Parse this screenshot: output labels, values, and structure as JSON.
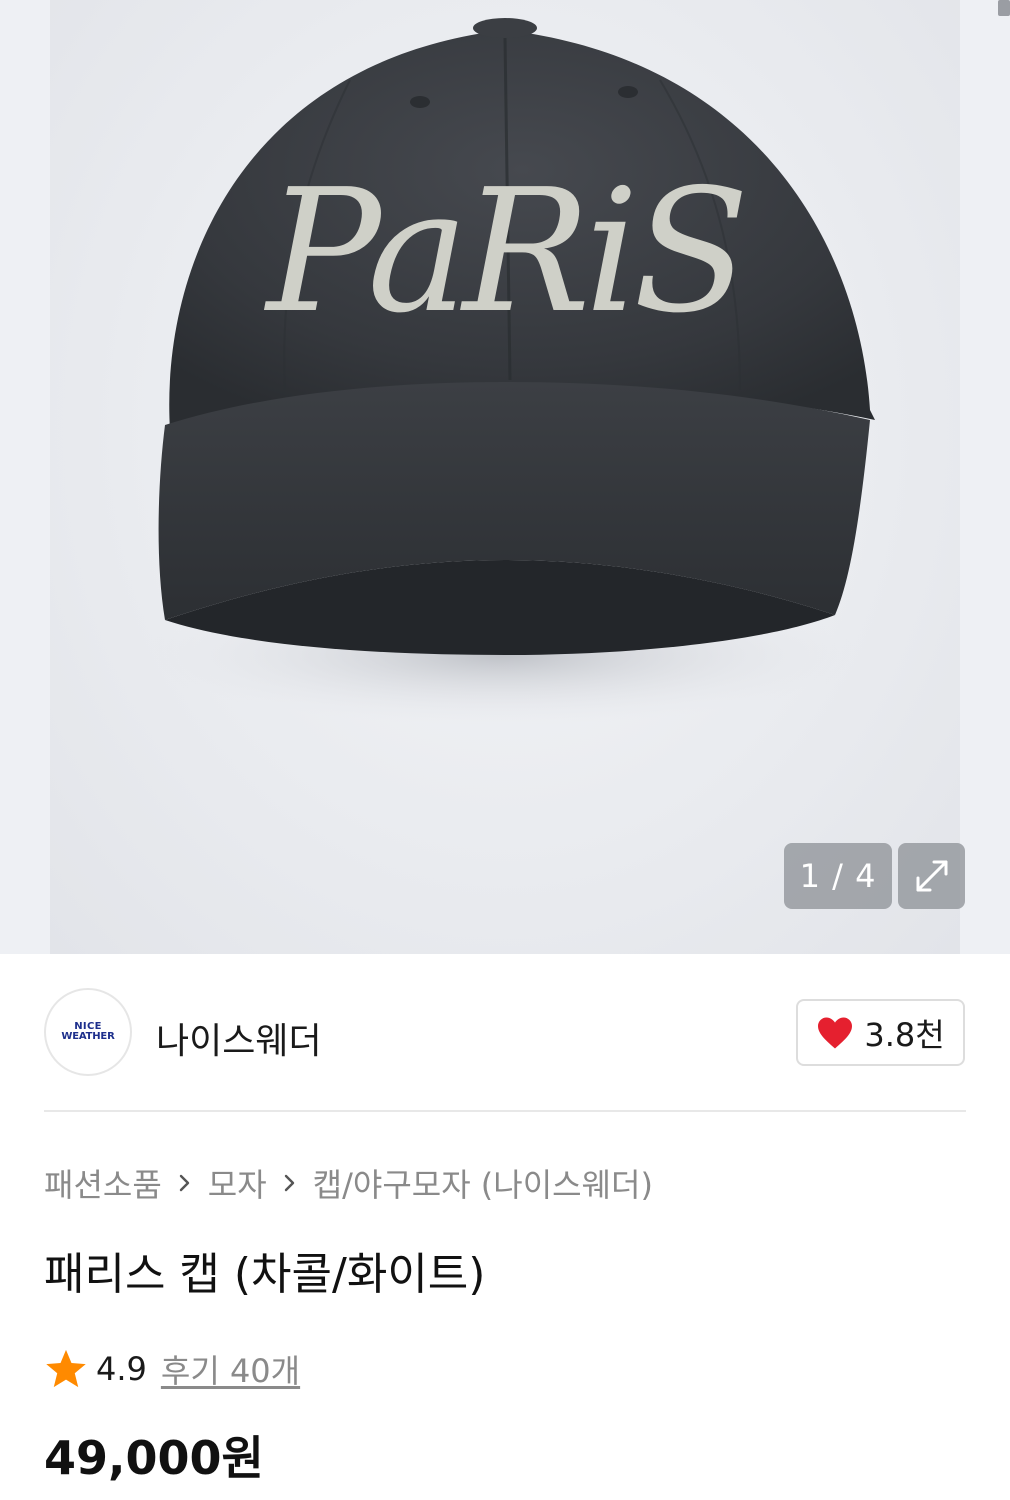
{
  "gallery": {
    "product_image": "charcoal baseball cap with PaRiS embroidery",
    "embroidery_text": "PaRiS",
    "counter": "1 / 4",
    "current_index": 1,
    "total_images": 4,
    "expand_icon": "expand-icon"
  },
  "brand": {
    "logo_line1": "NICE",
    "logo_line2": "WEATHER",
    "name": "나이스웨더",
    "like_count": "3.8천",
    "like_icon": "heart-icon",
    "like_color": "#e5202f"
  },
  "breadcrumb": {
    "items": [
      "패션소품",
      "모자",
      "캡/야구모자 (나이스웨더)"
    ],
    "separator_icon": "chevron-right-icon"
  },
  "product": {
    "title": "패리스 캡 (차콜/화이트)",
    "rating": "4.9",
    "rating_icon": "star-icon",
    "star_color": "#ff8a00",
    "review_label": "후기 40개",
    "price": "49,000원"
  }
}
